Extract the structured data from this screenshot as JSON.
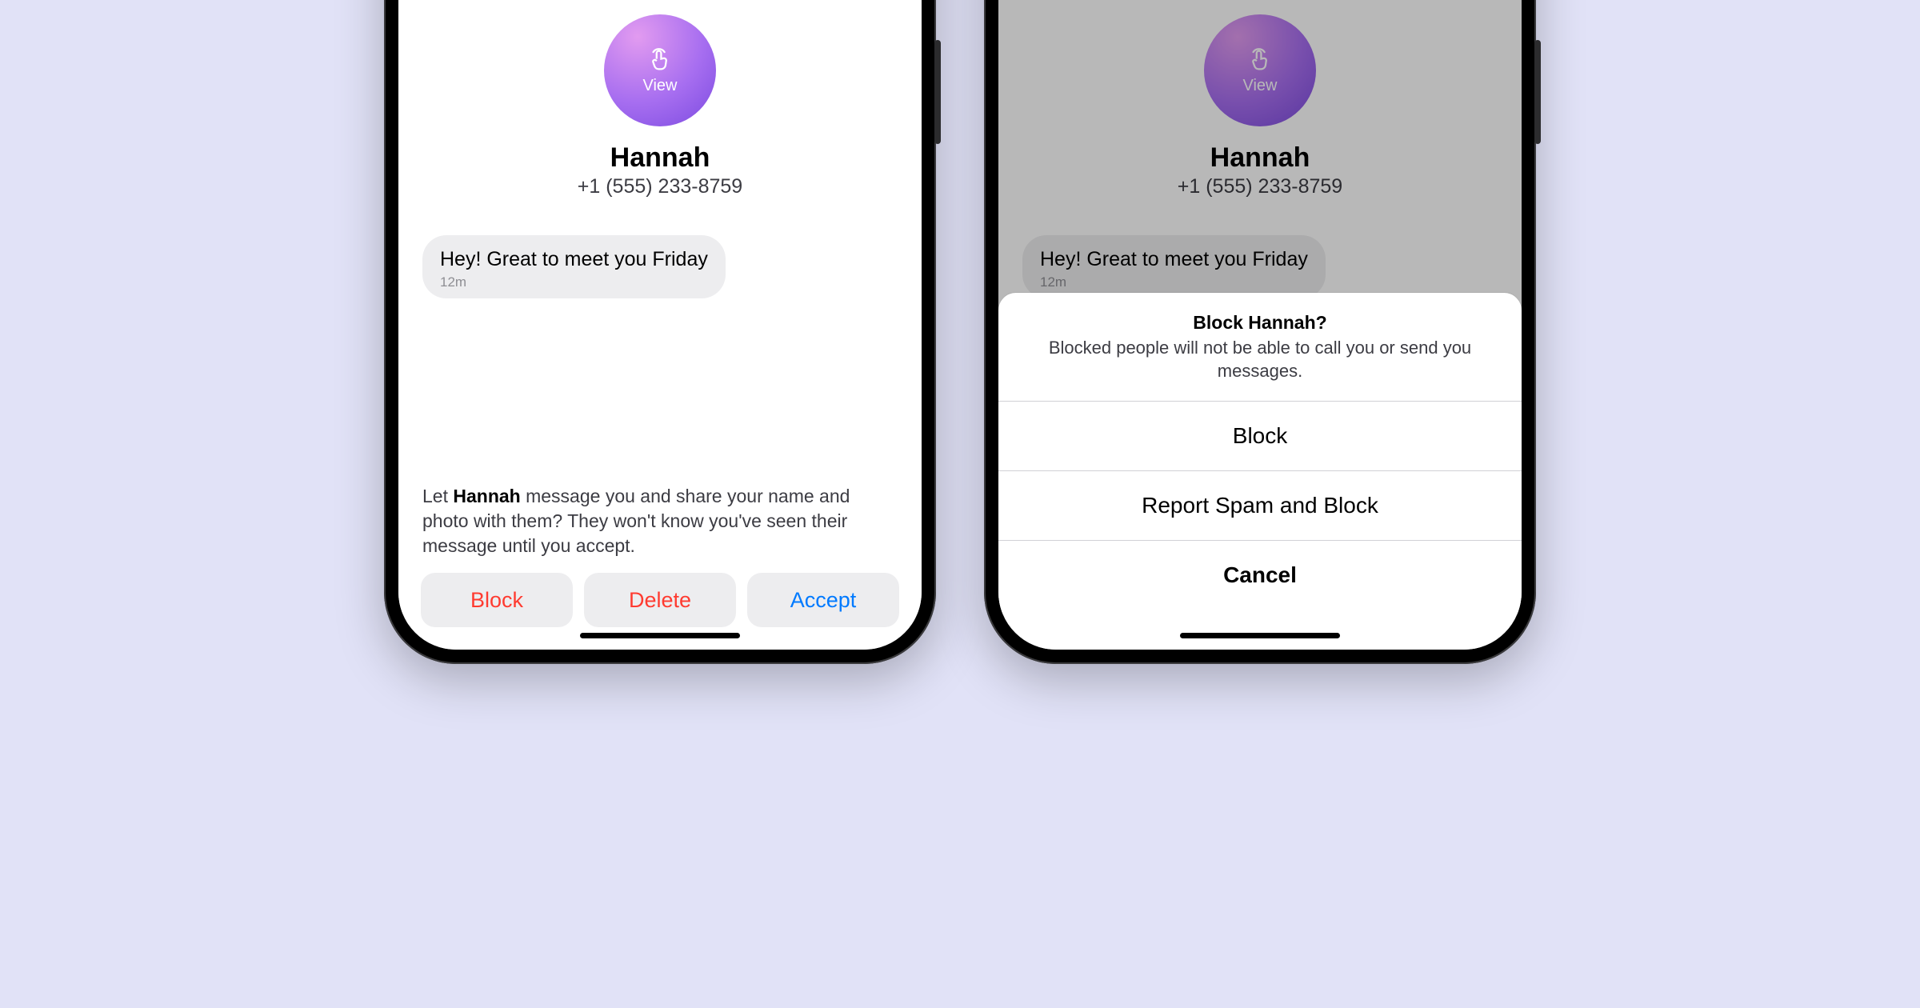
{
  "left": {
    "avatar_label": "View",
    "contact_name": "Hannah",
    "contact_phone": "+1 (555) 233-8759",
    "message_text": "Hey! Great to meet you Friday",
    "message_time": "12m",
    "prompt_prefix": "Let ",
    "prompt_name": "Hannah",
    "prompt_suffix": " message you and share your name and photo with them? They won't know you've seen their message until you accept.",
    "block_label": "Block",
    "delete_label": "Delete",
    "accept_label": "Accept"
  },
  "right": {
    "avatar_label": "View",
    "contact_name": "Hannah",
    "contact_phone": "+1 (555) 233-8759",
    "message_text": "Hey! Great to meet you Friday",
    "message_time": "12m",
    "sheet_title": "Block Hannah?",
    "sheet_subtitle": "Blocked people will not be able to call you or send you messages.",
    "option_block": "Block",
    "option_report": "Report Spam and Block",
    "option_cancel": "Cancel"
  }
}
